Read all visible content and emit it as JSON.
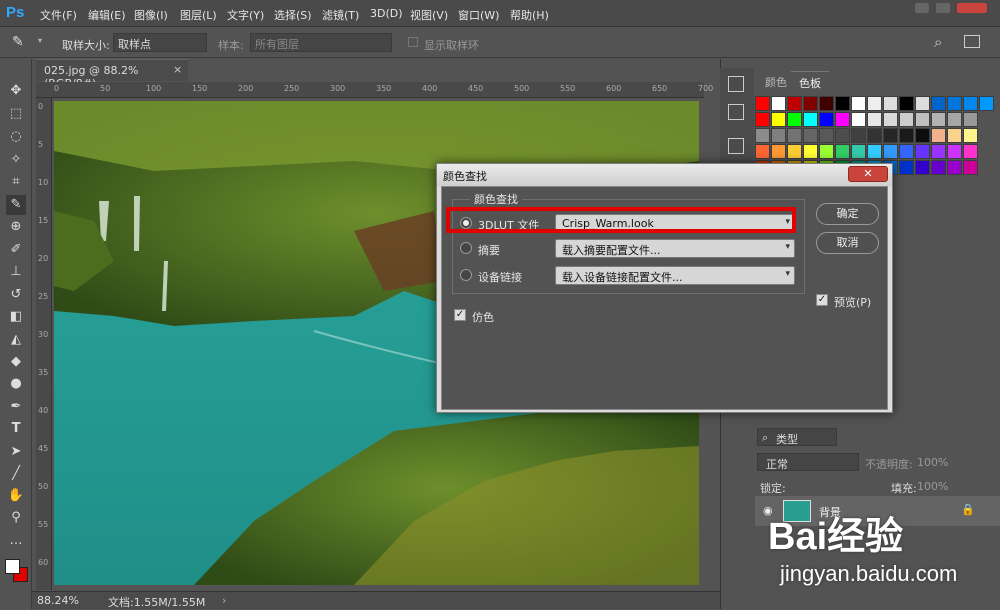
{
  "app": {
    "logo": "Ps"
  },
  "menu": [
    "文件(F)",
    "编辑(E)",
    "图像(I)",
    "图层(L)",
    "文字(Y)",
    "选择(S)",
    "滤镜(T)",
    "3D(D)",
    "视图(V)",
    "窗口(W)",
    "帮助(H)"
  ],
  "options": {
    "sample_size_label": "取样大小:",
    "sample_size_value": "取样点",
    "sample_label": "样本:",
    "sample_value": "所有图层",
    "show_ring_label": "显示取样环"
  },
  "document": {
    "tab_title": "025.jpg @ 88.2%(RGB/8#)",
    "tab_close": "×",
    "zoom": "88.24%",
    "doc_info": "文档:1.55M/1.55M",
    "ruler_h": [
      "0",
      "50",
      "100",
      "150",
      "200",
      "250",
      "300",
      "350",
      "400",
      "450",
      "500",
      "550",
      "600",
      "650",
      "700"
    ],
    "ruler_v": [
      "0",
      "5",
      "10",
      "15",
      "20",
      "25",
      "30",
      "35",
      "40",
      "45",
      "50",
      "55",
      "60"
    ]
  },
  "panels": {
    "tab_color": "颜色",
    "tab_swatches": "色板",
    "layers": {
      "kind_label": "类型",
      "blend_mode": "正常",
      "opacity_label": "不透明度:",
      "opacity_value": "100%",
      "lock_label": "锁定:",
      "fill_label": "填充:",
      "fill_value": "100%",
      "layer_name": "背景"
    }
  },
  "dialog": {
    "title": "颜色查找",
    "close": "✕",
    "group_label": "颜色查找",
    "options": [
      {
        "label": "3DLUT 文件",
        "value": "Crisp_Warm.look",
        "selected": true
      },
      {
        "label": "摘要",
        "value": "载入摘要配置文件...",
        "selected": false
      },
      {
        "label": "设备链接",
        "value": "载入设备链接配置文件...",
        "selected": false
      }
    ],
    "dither_label": "仿色",
    "ok": "确定",
    "cancel": "取消",
    "preview_label": "预览(P)"
  },
  "watermark": {
    "logo": "Bai经验",
    "url": "jingyan.baidu.com"
  },
  "colors": {
    "highlight": "#e00000",
    "accent": "#31a8ff"
  }
}
